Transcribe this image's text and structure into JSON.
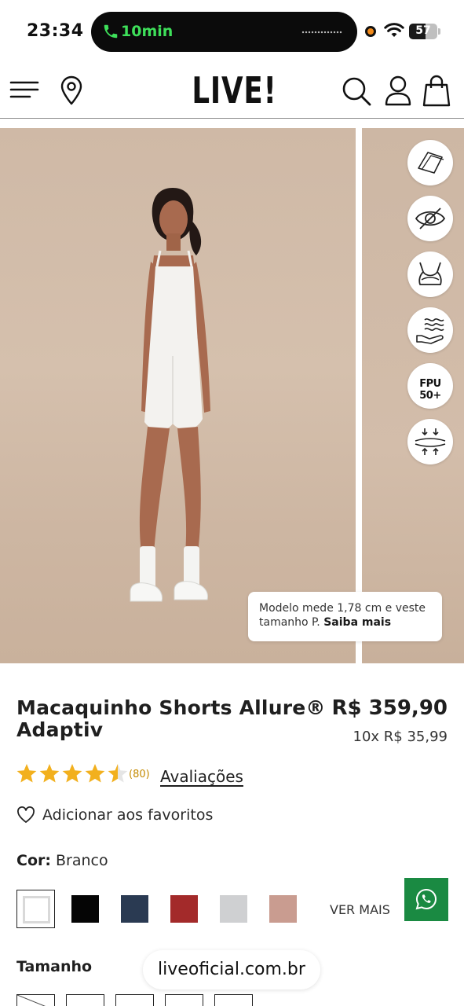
{
  "status_bar": {
    "time": "23:34",
    "call_duration": "10min",
    "battery": "57",
    "battery_fraction": 0.57
  },
  "header": {
    "logo": "LIVE!"
  },
  "gallery": {
    "feature_badges": [
      "fabric-icon",
      "opacity-icon",
      "support-icon",
      "moisture-icon",
      "FPU 50+",
      "compression-icon"
    ],
    "model_note_text": "Modelo mede 1,78 cm e veste tamanho P.",
    "model_note_link": "Saiba mais"
  },
  "product": {
    "title": "Macaquinho Shorts Allure® Adaptiv",
    "price": "R$ 359,90",
    "installments": "10x R$ 35,99",
    "rating_value": 4.5,
    "rating_count": "(80)",
    "reviews_link": "Avaliações",
    "favorite_label": "Adicionar aos favoritos",
    "color_label": "Cor:",
    "color_value": "Branco",
    "colors": [
      "#ffffff",
      "#050505",
      "#2a3a52",
      "#a32a2a",
      "#cfd0d2",
      "#c99c90"
    ],
    "more_colors": "VER MAIS",
    "size_label": "Tamanho"
  },
  "browser": {
    "url": "liveoficial.com.br"
  },
  "colors": {
    "whatsapp": "#1a8a42",
    "call_green": "#3ee05a",
    "star": "#f2b01e"
  }
}
